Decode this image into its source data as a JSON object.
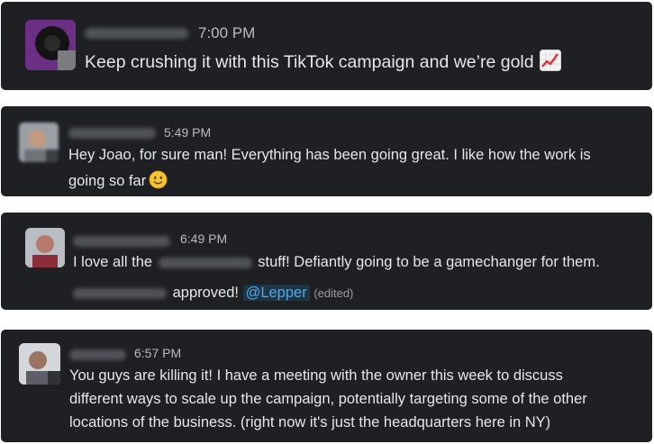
{
  "messages": [
    {
      "time": "7:00 PM",
      "text": "Keep crushing it with this TikTok campaign and we’re gold",
      "emoji": "chart-increasing-icon"
    },
    {
      "time": "5:49 PM",
      "line1": "Hey Joao, for sure man! Everything has been going great. I like how the work is",
      "line2": "going so far",
      "emoji": "slightly-smiling-face-icon"
    },
    {
      "time": "6:49 PM",
      "line1_a": "I love all the",
      "line1_b": "stuff! Defiantly going to be a gamechanger for them.",
      "line2_a": "approved!",
      "mention": "@Lepper",
      "edited": "(edited)"
    },
    {
      "time": "6:57 PM",
      "line1": "You guys are killing it! I have a meeting with the owner this week to discuss",
      "line2": "different ways to scale up the campaign, potentially targeting some of the other",
      "line3": "locations of the business. (right now it's just the headquarters here in NY)"
    }
  ],
  "colors": {
    "card_bg": "#1f2024",
    "text": "#e6e7e8",
    "timestamp": "#b9bbbe",
    "mention": "#4ea7f0",
    "page_bg": "#ffffff"
  }
}
